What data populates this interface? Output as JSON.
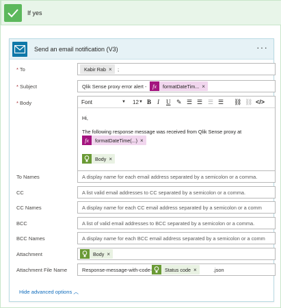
{
  "branch": {
    "label": "If yes"
  },
  "action": {
    "title": "Send an email notification (V3)",
    "more": "···"
  },
  "fields": {
    "to": {
      "label": "To",
      "required": true,
      "token": "Kabir Rab",
      "suffix": ";"
    },
    "subject": {
      "label": "Subject",
      "required": true,
      "text": "Qlik Sense proxy error alert - ",
      "token": "formatDateTim..."
    },
    "body": {
      "label": "Body",
      "required": true,
      "font": "Font",
      "size": "12",
      "line1": "Hi,",
      "line2": "The following response message was received from Qlik Sense proxy at",
      "token_fx": "formatDateTime(...)",
      "token_body": "Body"
    },
    "to_names": {
      "label": "To Names",
      "placeholder": "A display name for each email address separated by a semicolon or a comma."
    },
    "cc": {
      "label": "CC",
      "placeholder": "A list valid email addresses to CC separated by a semicolon or a comma."
    },
    "cc_names": {
      "label": "CC Names",
      "placeholder": "A display name for each CC email address separated by a semicolon or a comm"
    },
    "bcc": {
      "label": "BCC",
      "placeholder": "A list of valid email addresses to BCC separated by a semicolon or a comma."
    },
    "bcc_names": {
      "label": "BCC Names",
      "placeholder": "A display name for each BCC email address separated by a semicolon or a comm"
    },
    "attachment": {
      "label": "Attachment",
      "token": "Body"
    },
    "attachment_file_name": {
      "label": "Attachment File Name",
      "prefix": "Response-message-with-code-",
      "token": "Status code",
      "suffix": ".json"
    }
  },
  "advanced_toggle": "Hide advanced options",
  "colors": {
    "success": "#5cb85c",
    "mail": "#0f78a8",
    "expression": "#a4157f",
    "dynamic": "#6a9a35",
    "link": "#0f6cbd"
  }
}
